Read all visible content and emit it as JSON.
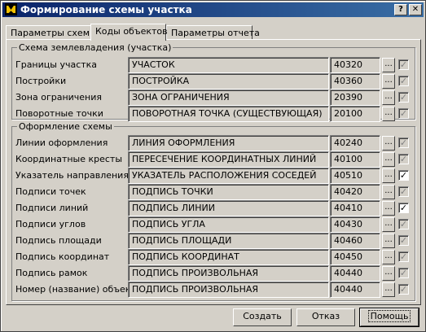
{
  "window": {
    "title": "Формирование схемы участка",
    "help_btn": "?",
    "close_btn": "x"
  },
  "tabs": [
    "Параметры схемы",
    "Коды объектов",
    "Параметры отчета"
  ],
  "active_tab": 1,
  "group1": {
    "legend": "Схема землевладения (участка)",
    "rows": [
      {
        "label": "Границы участка",
        "value": "УЧАСТОК",
        "code": "40320",
        "checked": true
      },
      {
        "label": "Постройки",
        "value": "ПОСТРОЙКА",
        "code": "40360",
        "checked": true
      },
      {
        "label": "Зона ограничения",
        "value": "ЗОНА ОГРАНИЧЕНИЯ",
        "code": "20390",
        "checked": true
      },
      {
        "label": "Поворотные точки",
        "value": "ПОВОРОТНАЯ ТОЧКА (СУЩЕСТВУЮЩАЯ)",
        "code": "20100",
        "checked": true
      }
    ]
  },
  "group2": {
    "legend": "Оформление схемы",
    "rows": [
      {
        "label": "Линии оформления",
        "value": "ЛИНИЯ ОФОРМЛЕНИЯ",
        "code": "40240",
        "checked": true,
        "enabled": false
      },
      {
        "label": "Координатные кресты",
        "value": "ПЕРЕСЕЧЕНИЕ КООРДИНАТНЫХ ЛИНИЙ",
        "code": "40100",
        "checked": true,
        "enabled": false
      },
      {
        "label": "Указатель направления",
        "value": "УКАЗАТЕЛЬ РАСПОЛОЖЕНИЯ СОСЕДЕЙ",
        "code": "40510",
        "checked": true,
        "enabled": true
      },
      {
        "label": "Подписи точек",
        "value": "ПОДПИСЬ ТОЧКИ",
        "code": "40420",
        "checked": true,
        "enabled": false
      },
      {
        "label": "Подписи линий",
        "value": "ПОДПИСЬ ЛИНИИ",
        "code": "40410",
        "checked": true,
        "enabled": true
      },
      {
        "label": "Подписи углов",
        "value": "ПОДПИСЬ УГЛА",
        "code": "40430",
        "checked": true,
        "enabled": false
      },
      {
        "label": "Подпись площади",
        "value": "ПОДПИСЬ ПЛОЩАДИ",
        "code": "40460",
        "checked": true,
        "enabled": false
      },
      {
        "label": "Подпись координат",
        "value": "ПОДПИСЬ КООРДИНАТ",
        "code": "40450",
        "checked": true,
        "enabled": false
      },
      {
        "label": "Подпись рамок",
        "value": "ПОДПИСЬ ПРОИЗВОЛЬНАЯ",
        "code": "40440",
        "checked": true,
        "enabled": false
      },
      {
        "label": "Номер (название) объекта",
        "value": "ПОДПИСЬ ПРОИЗВОЛЬНАЯ",
        "code": "40440",
        "checked": true,
        "enabled": false
      }
    ]
  },
  "browse_label": "...",
  "check_mark": "✓",
  "buttons": {
    "create": "Создать",
    "cancel": "Отказ",
    "help": "Помощь"
  }
}
